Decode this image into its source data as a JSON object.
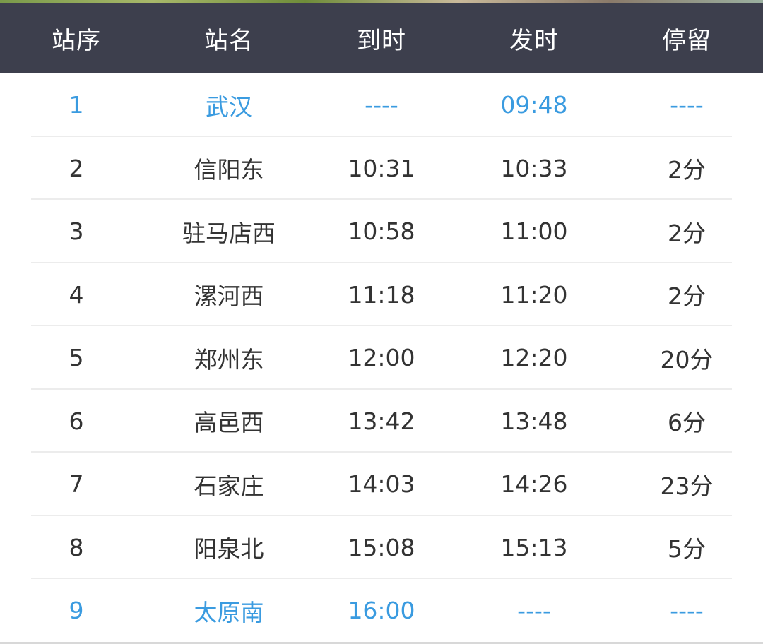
{
  "header": {
    "col_index": "站序",
    "col_station": "站名",
    "col_arrive": "到时",
    "col_depart": "发时",
    "col_stop": "停留"
  },
  "stops": [
    {
      "index": "1",
      "station": "武汉",
      "arrive": "----",
      "depart": "09:48",
      "stop": "----",
      "terminal": true
    },
    {
      "index": "2",
      "station": "信阳东",
      "arrive": "10:31",
      "depart": "10:33",
      "stop": "2分",
      "terminal": false
    },
    {
      "index": "3",
      "station": "驻马店西",
      "arrive": "10:58",
      "depart": "11:00",
      "stop": "2分",
      "terminal": false
    },
    {
      "index": "4",
      "station": "漯河西",
      "arrive": "11:18",
      "depart": "11:20",
      "stop": "2分",
      "terminal": false
    },
    {
      "index": "5",
      "station": "郑州东",
      "arrive": "12:00",
      "depart": "12:20",
      "stop": "20分",
      "terminal": false
    },
    {
      "index": "6",
      "station": "高邑西",
      "arrive": "13:42",
      "depart": "13:48",
      "stop": "6分",
      "terminal": false
    },
    {
      "index": "7",
      "station": "石家庄",
      "arrive": "14:03",
      "depart": "14:26",
      "stop": "23分",
      "terminal": false
    },
    {
      "index": "8",
      "station": "阳泉北",
      "arrive": "15:08",
      "depart": "15:13",
      "stop": "5分",
      "terminal": false
    },
    {
      "index": "9",
      "station": "太原南",
      "arrive": "16:00",
      "depart": "----",
      "stop": "----",
      "terminal": true
    }
  ],
  "colors": {
    "header_bg": "#3d3f4d",
    "header_text": "#ffffff",
    "row_text": "#333333",
    "terminal_text": "#3a9be0",
    "separator": "#ececec"
  }
}
